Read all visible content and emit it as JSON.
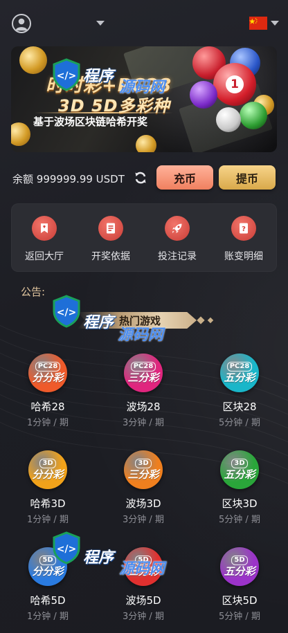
{
  "header": {
    "avatar_icon": "user-avatar-icon",
    "language_flag": "china-flag"
  },
  "banner": {
    "title": "时时彩+PC28",
    "subtitle": "3D 5D多彩种",
    "description": "基于波场区块链哈希开奖"
  },
  "account": {
    "balance_label": "余额",
    "balance_value": "999999.99 USDT",
    "recharge_label": "充币",
    "withdraw_label": "提币"
  },
  "quick_menu": [
    {
      "label": "返回大厅",
      "icon": "bookmark-icon"
    },
    {
      "label": "开奖依据",
      "icon": "document-icon"
    },
    {
      "label": "投注记录",
      "icon": "rocket-icon"
    },
    {
      "label": "账变明细",
      "icon": "question-doc-icon"
    }
  ],
  "notice": {
    "label": "公告:"
  },
  "hot_games": {
    "title": "热门游戏"
  },
  "watermark": {
    "part1": "程序",
    "part2": "源码网"
  },
  "games": [
    {
      "name": "哈希28",
      "period": "1分钟 / 期",
      "tag": "PC28",
      "big": "分分彩",
      "color": "#ef5a2a"
    },
    {
      "name": "波场28",
      "period": "3分钟 / 期",
      "tag": "PC28",
      "big": "三分彩",
      "color": "#e0257e"
    },
    {
      "name": "区块28",
      "period": "5分钟 / 期",
      "tag": "PC28",
      "big": "五分彩",
      "color": "#19b6c9"
    },
    {
      "name": "哈希3D",
      "period": "1分钟 / 期",
      "tag": "3D",
      "big": "分分彩",
      "color": "#f1a21a"
    },
    {
      "name": "波场3D",
      "period": "3分钟 / 期",
      "tag": "3D",
      "big": "三分彩",
      "color": "#ef7f1e"
    },
    {
      "name": "区块3D",
      "period": "5分钟 / 期",
      "tag": "3D",
      "big": "五分彩",
      "color": "#2aa63a"
    },
    {
      "name": "哈希5D",
      "period": "1分钟 / 期",
      "tag": "5D",
      "big": "分分彩",
      "color": "#2a7be0"
    },
    {
      "name": "波场5D",
      "period": "3分钟 / 期",
      "tag": "5D",
      "big": "三分彩",
      "color": "#e0302f"
    },
    {
      "name": "区块5D",
      "period": "5分钟 / 期",
      "tag": "5D",
      "big": "五分彩",
      "color": "#9b33c9"
    }
  ]
}
